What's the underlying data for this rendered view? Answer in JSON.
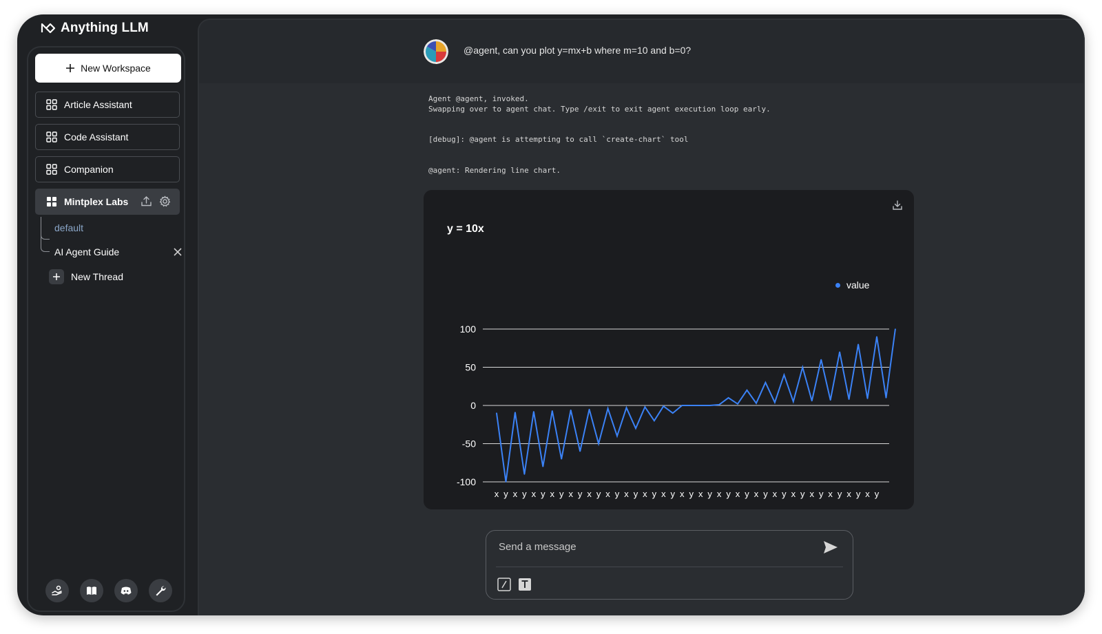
{
  "app": {
    "title": "Anything LLM"
  },
  "sidebar": {
    "new_workspace_label": "New Workspace",
    "workspaces": [
      {
        "label": "Article Assistant"
      },
      {
        "label": "Code Assistant"
      },
      {
        "label": "Companion"
      },
      {
        "label": "Mintplex Labs",
        "active": true
      }
    ],
    "threads": [
      {
        "label": "default"
      },
      {
        "label": "AI Agent Guide"
      }
    ],
    "new_thread_label": "New Thread",
    "footer_icons": [
      "support-icon",
      "docs-book-icon",
      "discord-icon",
      "settings-wrench-icon"
    ]
  },
  "chat": {
    "user_message": "@agent, can you plot y=mx+b where m=10 and b=0?",
    "log_lines": [
      "Agent @agent, invoked.\nSwapping over to agent chat. Type /exit to exit agent execution loop early.",
      "[debug]: @agent is attempting to call `create-chart` tool",
      "@agent: Rendering line chart."
    ]
  },
  "chart_data": {
    "type": "line",
    "title": "y = 10x",
    "legend": {
      "label": "value",
      "position": "top-right"
    },
    "ylim": [
      -100,
      100
    ],
    "yticks": [
      "100",
      "50",
      "0",
      "-50",
      "-100"
    ],
    "categories": [
      "x",
      "y",
      "x",
      "y",
      "x",
      "y",
      "x",
      "y",
      "x",
      "y",
      "x",
      "y",
      "x",
      "y",
      "x",
      "y",
      "x",
      "y",
      "x",
      "y",
      "x",
      "y",
      "x",
      "y",
      "x",
      "y",
      "x",
      "y",
      "x",
      "y",
      "x",
      "y",
      "x",
      "y",
      "x",
      "y",
      "x",
      "y",
      "x",
      "y",
      "x",
      "y"
    ],
    "series": [
      {
        "name": "value",
        "color": "#3b82f6",
        "values": [
          -10,
          -100,
          -9,
          -90,
          -8,
          -80,
          -7,
          -70,
          -6,
          -60,
          -5,
          -50,
          -4,
          -40,
          -3,
          -30,
          -2,
          -20,
          -1,
          -10,
          0,
          0,
          0,
          0,
          1,
          10,
          2,
          20,
          3,
          30,
          4,
          40,
          5,
          50,
          6,
          60,
          7,
          70,
          8,
          80,
          9,
          90,
          10,
          100
        ]
      }
    ],
    "grid": true
  },
  "composer": {
    "placeholder": "Send a message"
  },
  "colors": {
    "accent": "#3b82f6",
    "background": "#1f2124",
    "panel": "#2a2d31"
  }
}
